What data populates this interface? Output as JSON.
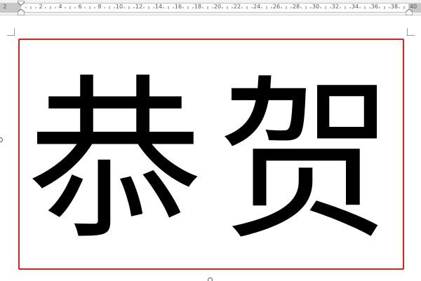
{
  "ruler": {
    "numbers": [
      "2",
      "2",
      "4",
      "6",
      "8",
      "10",
      "12",
      "14",
      "16",
      "18",
      "20",
      "22",
      "24",
      "26",
      "28",
      "30",
      "32",
      "34",
      "36",
      "38",
      "40"
    ]
  },
  "document": {
    "char1": "恭",
    "char2": "贺"
  },
  "colors": {
    "frame_border": "#e02020",
    "text": "#000000"
  }
}
